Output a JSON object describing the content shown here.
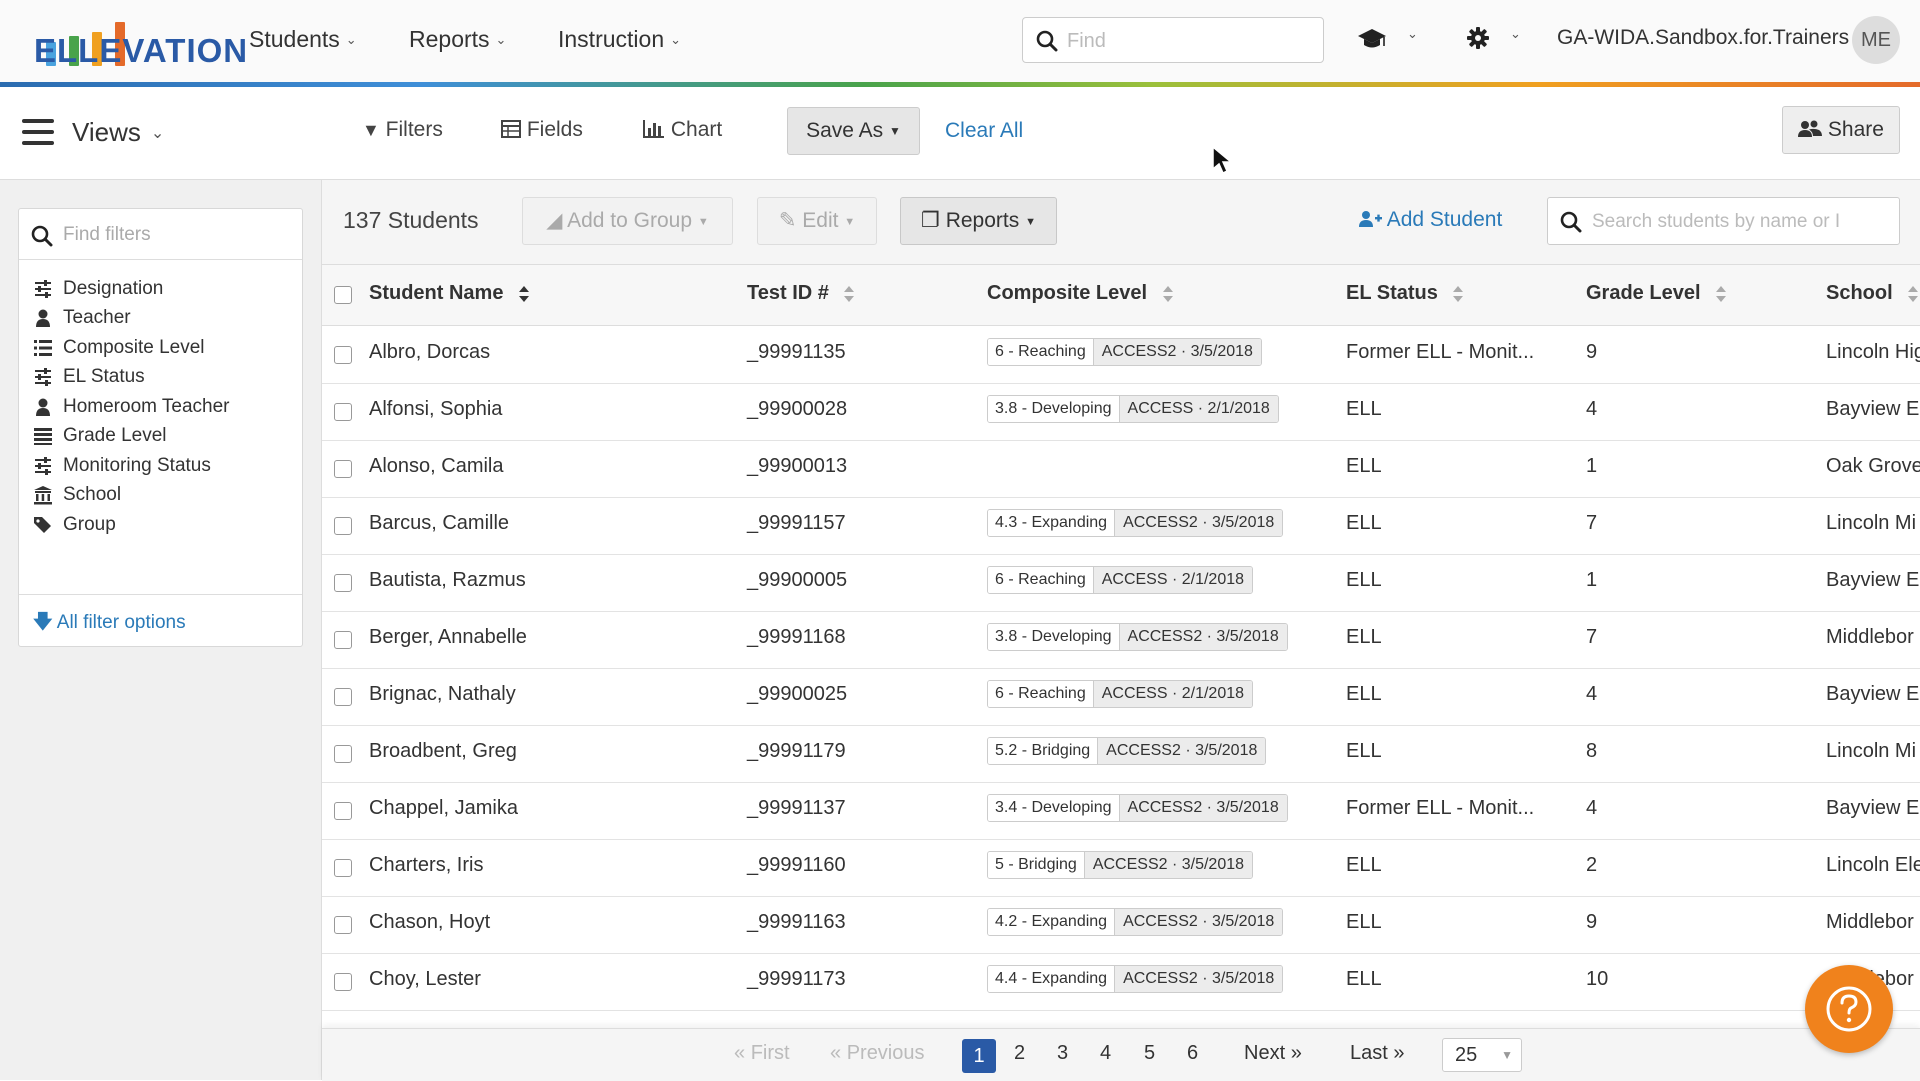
{
  "brand": {
    "logo_text": "ELLEVATION",
    "bar_colors": [
      "#4aa3df",
      "#49a34b",
      "#f0a020",
      "#e46a2a"
    ]
  },
  "topnav": {
    "items": [
      {
        "label": "Students"
      },
      {
        "label": "Reports"
      },
      {
        "label": "Instruction"
      }
    ],
    "find_placeholder": "Find",
    "account": "GA-WIDA.Sandbox.for.Trainers",
    "avatar_initials": "ME",
    "icons": [
      "graduation-cap-icon",
      "gear-icon"
    ]
  },
  "toolbar": {
    "views_label": "Views",
    "filters": "Filters",
    "fields": "Fields",
    "chart": "Chart",
    "save_as": "Save As",
    "clear_all": "Clear All",
    "share": "Share"
  },
  "sidebar": {
    "search_placeholder": "Find filters",
    "items": [
      {
        "label": "Designation",
        "icon": "sliders-icon"
      },
      {
        "label": "Teacher",
        "icon": "user-icon"
      },
      {
        "label": "Composite Level",
        "icon": "list-icon"
      },
      {
        "label": "EL Status",
        "icon": "sliders-icon"
      },
      {
        "label": "Homeroom Teacher",
        "icon": "user-icon"
      },
      {
        "label": "Grade Level",
        "icon": "bars-icon"
      },
      {
        "label": "Monitoring Status",
        "icon": "sliders-icon"
      },
      {
        "label": "School",
        "icon": "institution-icon"
      },
      {
        "label": "Group",
        "icon": "tags-icon"
      }
    ],
    "all_filter_options": "All filter options"
  },
  "actions": {
    "student_count": "137 Students",
    "add_to_group": "Add to Group",
    "edit": "Edit",
    "reports": "Reports",
    "add_student": "Add Student",
    "search_placeholder": "Search students by name or I"
  },
  "table": {
    "columns": [
      "Student Name",
      "Test ID #",
      "Composite Level",
      "EL Status",
      "Grade Level",
      "School"
    ],
    "rows": [
      {
        "name": "Albro, Dorcas",
        "test_id": "_99991135",
        "level": "6 - Reaching",
        "test": "ACCESS2 · 3/5/2018",
        "status": "Former ELL - Monit...",
        "grade": "9",
        "school": "Lincoln Hig"
      },
      {
        "name": "Alfonsi, Sophia",
        "test_id": "_99900028",
        "level": "3.8 - Developing",
        "test": "ACCESS · 2/1/2018",
        "status": "ELL",
        "grade": "4",
        "school": "Bayview E"
      },
      {
        "name": "Alonso, Camila",
        "test_id": "_99900013",
        "level": "",
        "test": "",
        "status": "ELL",
        "grade": "1",
        "school": "Oak Grove"
      },
      {
        "name": "Barcus, Camille",
        "test_id": "_99991157",
        "level": "4.3 - Expanding",
        "test": "ACCESS2 · 3/5/2018",
        "status": "ELL",
        "grade": "7",
        "school": "Lincoln Mi"
      },
      {
        "name": "Bautista, Razmus",
        "test_id": "_99900005",
        "level": "6 - Reaching",
        "test": "ACCESS · 2/1/2018",
        "status": "ELL",
        "grade": "1",
        "school": "Bayview E"
      },
      {
        "name": "Berger, Annabelle",
        "test_id": "_99991168",
        "level": "3.8 - Developing",
        "test": "ACCESS2 · 3/5/2018",
        "status": "ELL",
        "grade": "7",
        "school": "Middlebor"
      },
      {
        "name": "Brignac, Nathaly",
        "test_id": "_99900025",
        "level": "6 - Reaching",
        "test": "ACCESS · 2/1/2018",
        "status": "ELL",
        "grade": "4",
        "school": "Bayview E"
      },
      {
        "name": "Broadbent, Greg",
        "test_id": "_99991179",
        "level": "5.2 - Bridging",
        "test": "ACCESS2 · 3/5/2018",
        "status": "ELL",
        "grade": "8",
        "school": "Lincoln Mi"
      },
      {
        "name": "Chappel, Jamika",
        "test_id": "_99991137",
        "level": "3.4 - Developing",
        "test": "ACCESS2 · 3/5/2018",
        "status": "Former ELL - Monit...",
        "grade": "4",
        "school": "Bayview E"
      },
      {
        "name": "Charters, Iris",
        "test_id": "_99991160",
        "level": "5 - Bridging",
        "test": "ACCESS2 · 3/5/2018",
        "status": "ELL",
        "grade": "2",
        "school": "Lincoln Ele"
      },
      {
        "name": "Chason, Hoyt",
        "test_id": "_99991163",
        "level": "4.2 - Expanding",
        "test": "ACCESS2 · 3/5/2018",
        "status": "ELL",
        "grade": "9",
        "school": "Middlebor"
      },
      {
        "name": "Choy, Lester",
        "test_id": "_99991173",
        "level": "4.4 - Expanding",
        "test": "ACCESS2 · 3/5/2018",
        "status": "ELL",
        "grade": "10",
        "school": "Middlebor"
      }
    ]
  },
  "pager": {
    "first": "First",
    "previous": "Previous",
    "pages": [
      "1",
      "2",
      "3",
      "4",
      "5",
      "6"
    ],
    "current": "1",
    "next": "Next",
    "last": "Last",
    "page_size": "25"
  },
  "colors": {
    "accent": "#2a5aa6",
    "link": "#2a7ab8",
    "help": "#f0821c"
  }
}
